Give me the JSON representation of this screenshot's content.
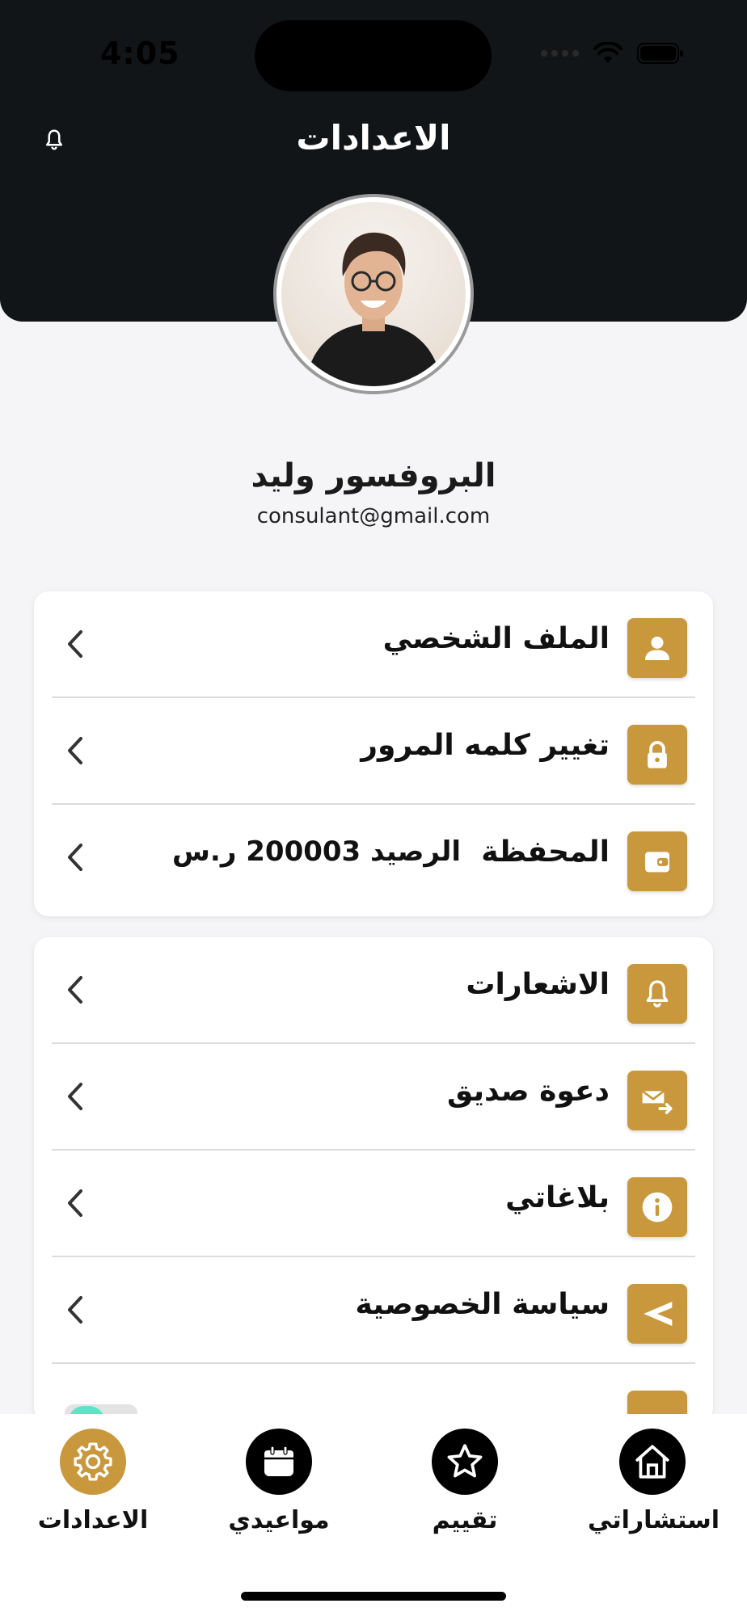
{
  "status_bar": {
    "time": "4:05"
  },
  "header": {
    "title": "الاعدادات"
  },
  "profile": {
    "name": "البروفسور وليد",
    "email": "consulant@gmail.com"
  },
  "account_section": [
    {
      "label": "الملف الشخصي",
      "icon": "person-icon"
    },
    {
      "label": "تغيير كلمه المرور",
      "icon": "lock-icon"
    },
    {
      "label": "المحفظة",
      "sublabel": "الرصيد 200003 ر.س",
      "icon": "wallet-icon"
    }
  ],
  "general_section": [
    {
      "label": "الاشعارات",
      "icon": "bell-icon"
    },
    {
      "label": "دعوة صديق",
      "icon": "mail-forward-icon"
    },
    {
      "label": "بلاغاتي",
      "icon": "info-icon"
    },
    {
      "label": "سياسة الخصوصية",
      "icon": "privacy-arrow-icon"
    }
  ],
  "tabbar": [
    {
      "label": "الاعدادات",
      "icon": "gear-icon",
      "active": true
    },
    {
      "label": "مواعيدي",
      "icon": "calendar-icon",
      "active": false
    },
    {
      "label": "تقييم",
      "icon": "star-icon",
      "active": false
    },
    {
      "label": "استشاراتي",
      "icon": "home-icon",
      "active": false
    }
  ],
  "colors": {
    "accent": "#c9983d",
    "header_bg": "#121517",
    "page_bg": "#f5f5f7",
    "toggle_on": "#5fe3c7"
  }
}
